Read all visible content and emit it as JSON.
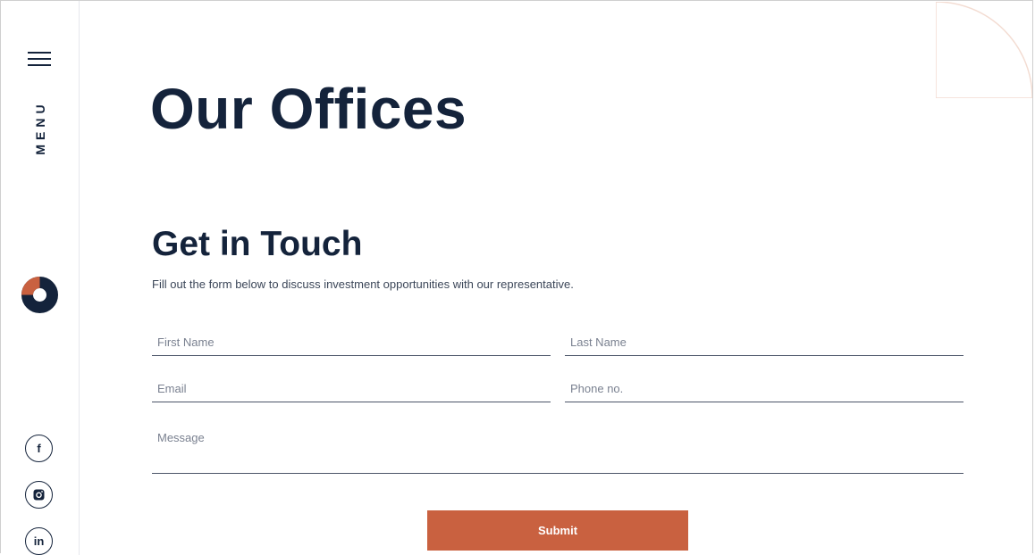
{
  "sidebar": {
    "menu_label": "MENU",
    "social": [
      {
        "icon": "facebook-icon",
        "glyph": "f"
      },
      {
        "icon": "instagram-icon",
        "glyph": "◎"
      },
      {
        "icon": "linkedin-icon",
        "glyph": "in"
      }
    ]
  },
  "page": {
    "title": "Our Offices"
  },
  "contact": {
    "heading": "Get in Touch",
    "description": "Fill out the form below to discuss investment opportunities with our representative.",
    "first_name_placeholder": "First Name",
    "last_name_placeholder": "Last Name",
    "email_placeholder": "Email",
    "phone_placeholder": "Phone no.",
    "message_placeholder": "Message",
    "submit_label": "Submit"
  },
  "colors": {
    "navy": "#14233b",
    "accent": "#c96140"
  }
}
